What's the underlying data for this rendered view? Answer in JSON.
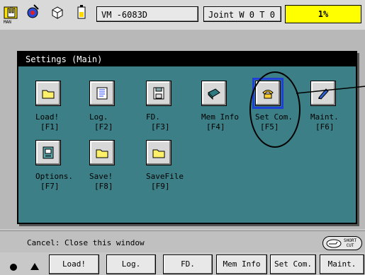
{
  "topbar": {
    "mode_label": "MAN",
    "program_box": "VM   -6083D",
    "coord_box": "Joint  W 0 T 0",
    "speed": "1%",
    "accent_color": "#ffff00"
  },
  "window": {
    "title": "Settings (Main)",
    "background": "#3c7f86",
    "items": [
      {
        "label": "Load!",
        "key": "[F1]",
        "icon": "folder-icon"
      },
      {
        "label": "Log.",
        "key": "[F2]",
        "icon": "log-book-icon"
      },
      {
        "label": "FD.",
        "key": "[F3]",
        "icon": "floppy-disk-icon"
      },
      {
        "label": "Mem Info",
        "key": "[F4]",
        "icon": "memory-card-icon"
      },
      {
        "label": "Set Com.",
        "key": "[F5]",
        "icon": "telephone-icon"
      },
      {
        "label": "Maint.",
        "key": "[F6]",
        "icon": "pen-icon"
      },
      {
        "label": "Options.",
        "key": "[F7]",
        "icon": "options-device-icon"
      },
      {
        "label": "Save!",
        "key": "[F8]",
        "icon": "folder-icon"
      },
      {
        "label": "SaveFile",
        "key": "[F9]",
        "icon": "folder-icon"
      }
    ],
    "selected_item": "Set Com."
  },
  "status": {
    "text": "Cancel: Close this window",
    "shortcut_line1": "SHORT",
    "shortcut_line2": "CUT"
  },
  "fkeys": [
    "Load!",
    "Log.",
    "FD.",
    "Mem Info",
    "Set Com.",
    "Maint."
  ]
}
